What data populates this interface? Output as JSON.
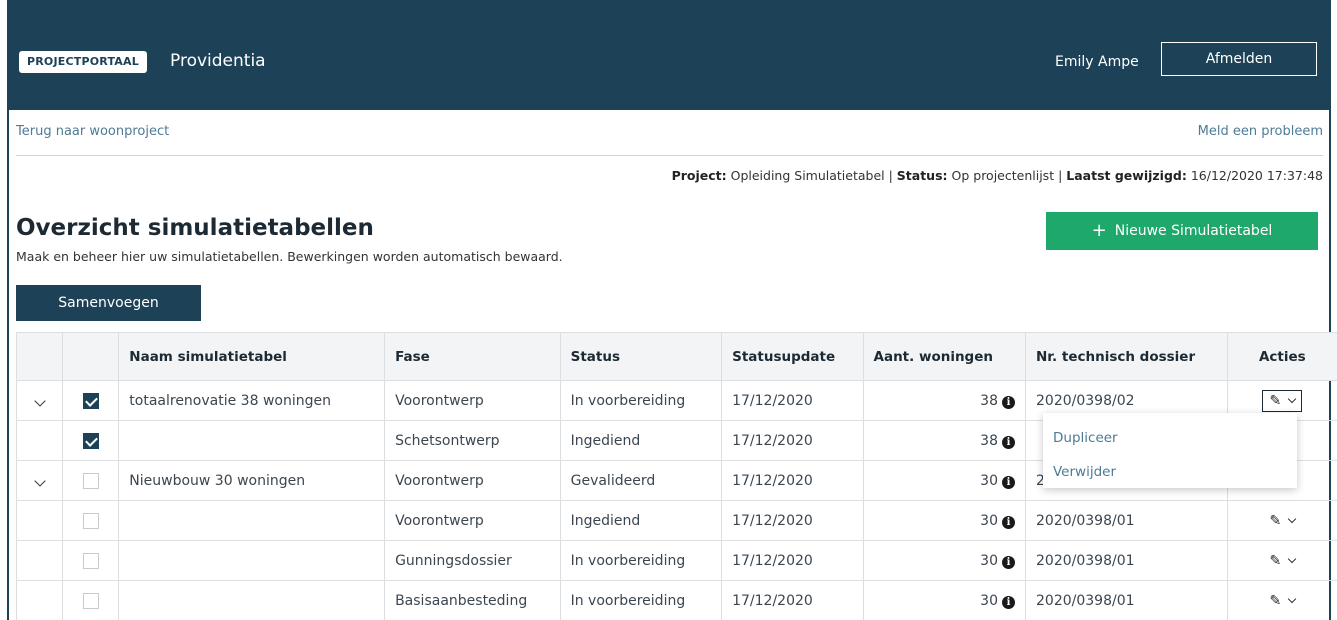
{
  "header": {
    "badge": "PROJECTPORTAAL",
    "app_name": "Providentia",
    "user": "Emily Ampe",
    "logout_label": "Afmelden"
  },
  "nav": {
    "back_link": "Terug naar woonproject",
    "report_link": "Meld een probleem"
  },
  "meta": {
    "project_label": "Project:",
    "project_value": "Opleiding Simulatietabel",
    "status_label": "Status:",
    "status_value": "Op projectenlijst",
    "modified_label": "Laatst gewijzigd:",
    "modified_value": "16/12/2020 17:37:48"
  },
  "page": {
    "title": "Overzicht simulatietabellen",
    "subtitle": "Maak en beheer hier uw simulatietabellen. Bewerkingen worden automatisch bewaard.",
    "new_button": "Nieuwe Simulatietabel",
    "merge_button": "Samenvoegen"
  },
  "table": {
    "headers": [
      "",
      "",
      "Naam simulatietabel",
      "Fase",
      "Status",
      "Statusupdate",
      "Aant. woningen",
      "Nr. technisch dossier",
      "Acties"
    ],
    "rows": [
      {
        "expand": true,
        "checked": true,
        "name": "totaalrenovatie 38 woningen",
        "fase": "Voorontwerp",
        "status": "In voorbereiding",
        "update": "17/12/2020",
        "woningen": "38",
        "dossier": "2020/0398/02"
      },
      {
        "expand": false,
        "checked": true,
        "name": "",
        "fase": "Schetsontwerp",
        "status": "Ingediend",
        "update": "17/12/2020",
        "woningen": "38",
        "dossier": ""
      },
      {
        "expand": true,
        "checked": false,
        "name": "Nieuwbouw 30 woningen",
        "fase": "Voorontwerp",
        "status": "Gevalideerd",
        "update": "17/12/2020",
        "woningen": "30",
        "dossier": "2"
      },
      {
        "expand": false,
        "checked": false,
        "name": "",
        "fase": "Voorontwerp",
        "status": "Ingediend",
        "update": "17/12/2020",
        "woningen": "30",
        "dossier": "2020/0398/01"
      },
      {
        "expand": false,
        "checked": false,
        "name": "",
        "fase": "Gunningsdossier",
        "status": "In voorbereiding",
        "update": "17/12/2020",
        "woningen": "30",
        "dossier": "2020/0398/01"
      },
      {
        "expand": false,
        "checked": false,
        "name": "",
        "fase": "Basisaanbesteding",
        "status": "In voorbereiding",
        "update": "17/12/2020",
        "woningen": "30",
        "dossier": "2020/0398/01"
      }
    ]
  },
  "dropdown": {
    "items": [
      "Dupliceer",
      "Verwijder"
    ]
  },
  "icons": {
    "info": "info-icon",
    "edit": "pencil-icon",
    "expand": "chevron-down-icon"
  },
  "colors": {
    "header_bg": "#1d4257",
    "primary_green": "#1fa86b",
    "link": "#4e7b95"
  }
}
